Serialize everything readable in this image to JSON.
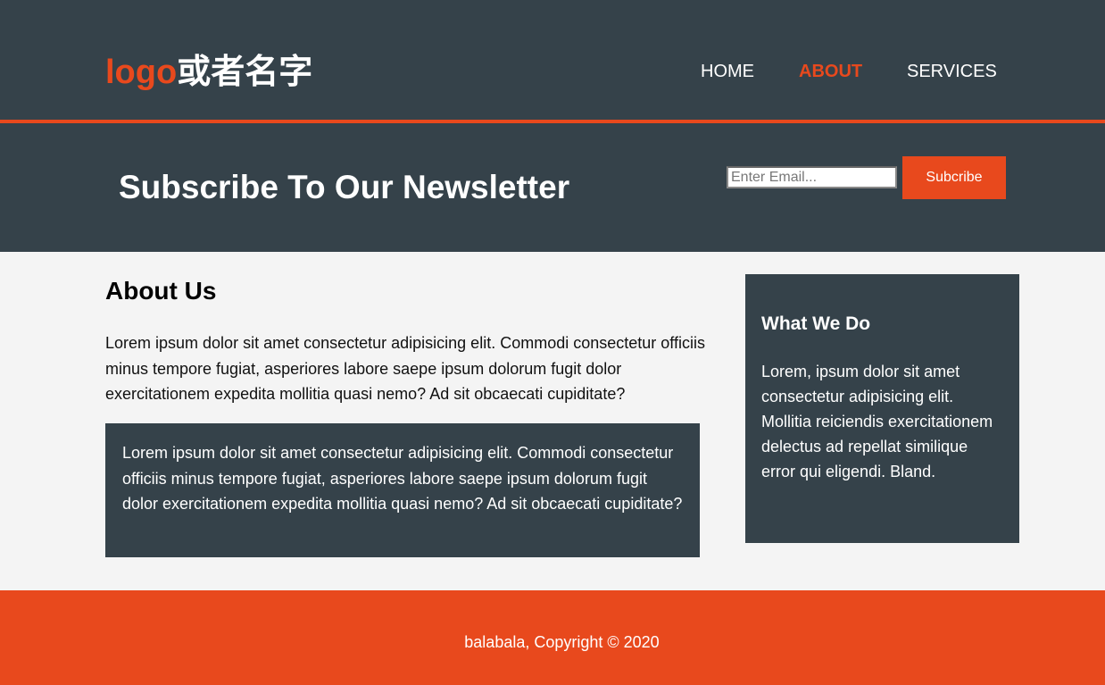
{
  "header": {
    "logo_accent": "logo",
    "logo_rest": "或者名字",
    "nav": [
      {
        "label": "HOME",
        "active": false
      },
      {
        "label": "ABOUT",
        "active": true
      },
      {
        "label": "SERVICES",
        "active": false
      }
    ]
  },
  "newsletter": {
    "title": "Subscribe To Our Newsletter",
    "email_placeholder": "Enter Email...",
    "button_label": "Subcribe"
  },
  "main": {
    "title": "About Us",
    "paragraph": "Lorem ipsum dolor sit amet consectetur adipisicing elit. Commodi consectetur officiis minus tempore fugiat, asperiores labore saepe ipsum dolorum fugit dolor exercitationem expedita mollitia quasi nemo? Ad sit obcaecati cupiditate?",
    "dark_box_text": "Lorem ipsum dolor sit amet consectetur adipisicing elit. Commodi consectetur officiis minus tempore fugiat, asperiores labore saepe ipsum dolorum fugit dolor exercitationem expedita mollitia quasi nemo? Ad sit obcaecati cupiditate?"
  },
  "sidebar": {
    "title": "What We Do",
    "text": "Lorem, ipsum dolor sit amet consectetur adipisicing elit. Mollitia reiciendis exercitationem delectus ad repellat similique error qui eligendi. Bland."
  },
  "footer": {
    "copyright": "balabala, Copyright © 2020"
  },
  "colors": {
    "dark": "#35424a",
    "accent": "#e8491d",
    "background": "#f4f4f4"
  }
}
